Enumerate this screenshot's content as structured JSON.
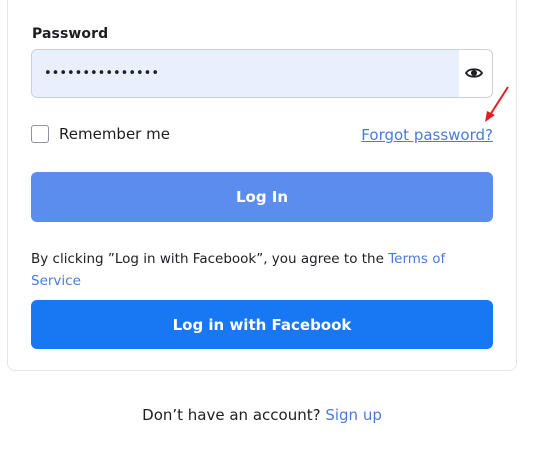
{
  "form": {
    "password_label": "Password",
    "password_value": "•••••••••••••••",
    "remember_label": "Remember me",
    "forgot_label": "Forgot password?",
    "login_label": "Log In",
    "terms_text": "By clicking ”Log in with Facebook”, you agree to the ",
    "terms_link": "Terms of Service",
    "facebook_label": "Log in with Facebook"
  },
  "footer": {
    "prompt": "Don’t have an account? ",
    "signup_label": "Sign up"
  },
  "icons": {
    "password_toggle": "eye-icon",
    "annotation": "red-arrow-icon"
  },
  "colors": {
    "login_button": "#5b8def",
    "facebook_button": "#1877f2",
    "link": "#4a7bd8",
    "input_fill": "#e8f0fe",
    "annotation_arrow": "#e02020"
  }
}
